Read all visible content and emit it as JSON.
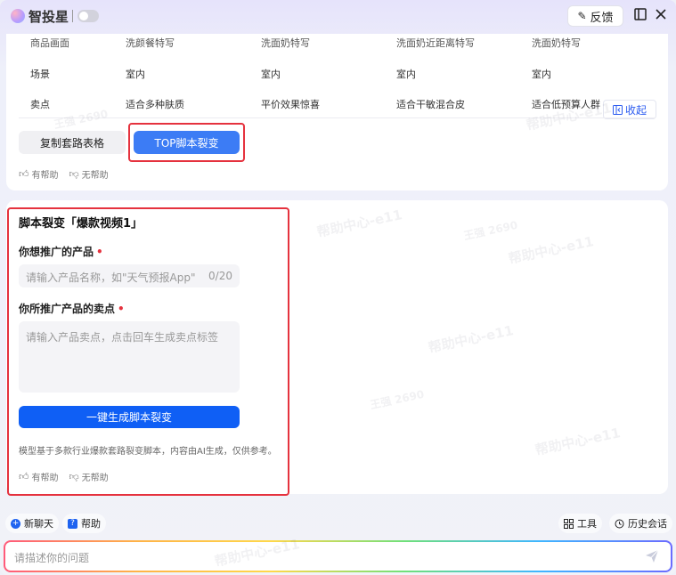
{
  "header": {
    "app_name": "智投星",
    "feedback_label": "反馈"
  },
  "table": {
    "rows": [
      {
        "cells": [
          "商品画面",
          "洗颜餐特写",
          "洗面奶特写",
          "洗面奶近距离特写",
          "洗面奶特写"
        ]
      },
      {
        "cells": [
          "场景",
          "室内",
          "室内",
          "室内",
          "室内"
        ]
      },
      {
        "cells": [
          "卖点",
          "适合多种肤质",
          "平价效果惊喜",
          "适合干敏混合皮",
          "适合低预算人群"
        ]
      }
    ],
    "collapse_label": "收起"
  },
  "actions": {
    "copy_table_label": "复制套路表格",
    "top_script_label": "TOP脚本裂变"
  },
  "feedback_row": {
    "helpful_label": "有帮助",
    "unhelpful_label": "无帮助"
  },
  "form": {
    "title": "脚本裂变「爆款视频1」",
    "product_label": "你想推广的产品",
    "product_placeholder": "请输入产品名称，如\"天气预报App\"",
    "product_counter": "0/20",
    "selling_label": "你所推广产品的卖点",
    "selling_placeholder": "请输入产品卖点，点击回车生成卖点标签",
    "generate_label": "一键生成脚本裂变",
    "disclaimer": "模型基于多款行业爆款套路裂变脚本，内容由AI生成，仅供参考。",
    "helpful_label": "有帮助",
    "unhelpful_label": "无帮助"
  },
  "bottom_bar": {
    "new_chat_label": "新聊天",
    "help_label": "帮助",
    "tools_label": "工具",
    "history_label": "历史会话"
  },
  "chat": {
    "placeholder": "请描述你的问题"
  },
  "watermark": {
    "text_a": "帮助中心-e11",
    "text_b": "王强 2690"
  },
  "colors": {
    "primary": "#3c7cf5",
    "generate_button": "#0f5ff5",
    "highlight_border": "#e5323e"
  }
}
